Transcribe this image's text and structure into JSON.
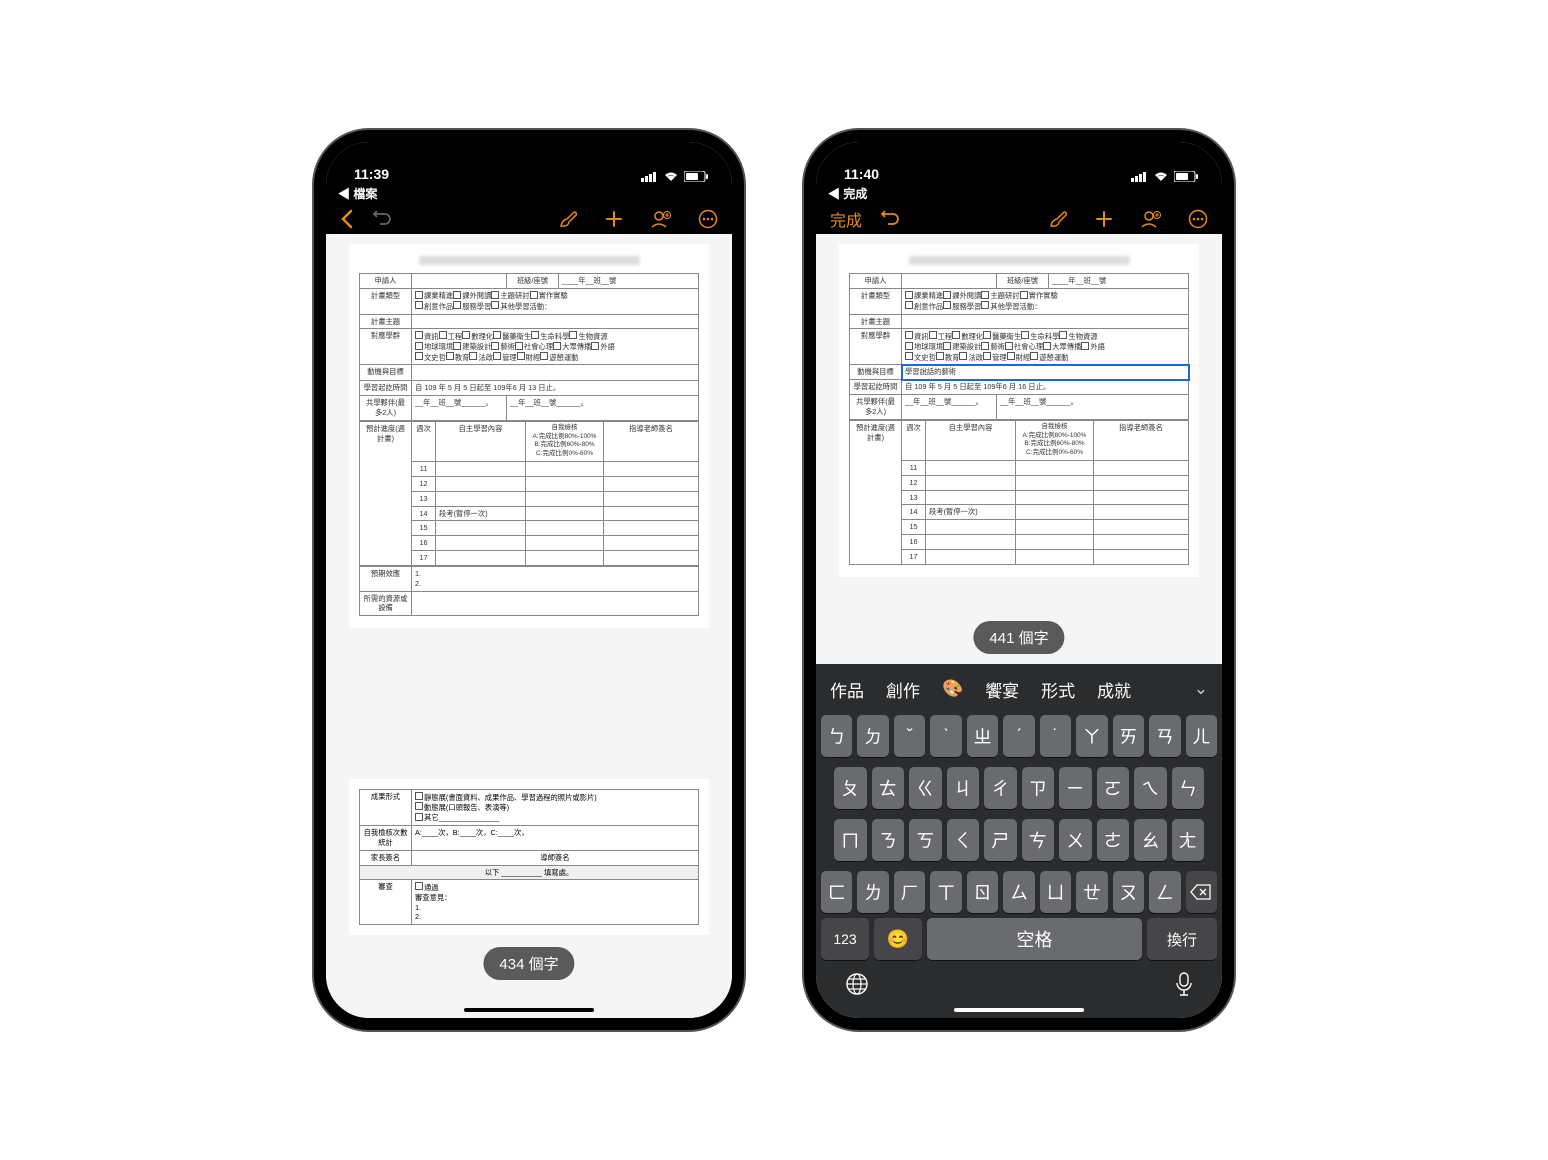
{
  "phoneA": {
    "status": {
      "time": "11:39",
      "backApp": "◀ 檔案"
    },
    "wordCount": "434 個字",
    "form": {
      "row_applicant": "申請人",
      "class_label": "班級/座號",
      "class_value": "____年__班__號",
      "planType_label": "計畫類型",
      "planType_opts": [
        "課業精進",
        "課外閱讀",
        "主題研討",
        "實作實驗",
        "創意作品",
        "服務學習",
        "其他學習活動："
      ],
      "planTopic_label": "計畫主題",
      "group_label": "對應學群",
      "group_opts": [
        "資訊",
        "工程",
        "數理化",
        "醫藥衛生",
        "生命科學",
        "生物資源",
        "地球環境",
        "建築設計",
        "藝術",
        "社會心理",
        "大眾傳播",
        "外語",
        "文史哲",
        "教育",
        "法政",
        "管理",
        "財經",
        "遊憩運動"
      ],
      "motive_label": "動機與目標",
      "period_label": "學習起訖時間",
      "period_value": "自 109 年 5 月 5 日起至 109年6 月 13 日止。",
      "partner_label": "共學夥伴(最多2人)",
      "partner_value1": "__年__班__號______。",
      "partner_value2": "__年__班__號______。",
      "schedule_label": "預計進度(週計畫)",
      "cols": [
        "週次",
        "自主學習內容",
        "自我檢核",
        "指導老師簽名"
      ],
      "checkDesc": [
        "A:完成比例80%-100%",
        "B:完成比例60%-80%",
        "C:完成比例0%-60%"
      ],
      "weeks": [
        "11",
        "12",
        "13",
        "14",
        "15",
        "16",
        "17"
      ],
      "exam": "段考(暫停一次)",
      "expect_label": "預期效應",
      "resource_label": "所需的資源或設備",
      "result_label": "成果形式",
      "result_opts": [
        "靜態展(書面資料、成果作品、學習過程的照片或影片)",
        "動態展(口頭報告、表演等)",
        "其它_______________"
      ],
      "selfcheck_label": "自我檢核次數統計",
      "selfcheck_value": "A:____次，B:____次，C:____次，",
      "parent_label": "家長簽名",
      "teacher_label": "導師簽名",
      "line_below": "以下 __________ 填寫處。",
      "review_label": "審查",
      "review_opt": "通過",
      "review_opinion": "審查意見："
    }
  },
  "phoneB": {
    "status": {
      "time": "11:40",
      "backApp": "◀ 完成"
    },
    "done": "完成",
    "wordCount": "441 個字",
    "formInput": "學習說話的藝術",
    "period_value": "自 109 年 5 月 5 日起至 109年6 月 16 日止。",
    "candidates": [
      "作品",
      "創作",
      "🎨",
      "饗宴",
      "形式",
      "成就"
    ],
    "kbRows": [
      [
        "ㄅ",
        "ㄉ",
        "ˇ",
        "ˋ",
        "ㄓ",
        "ˊ",
        "˙",
        "ㄚ",
        "ㄞ",
        "ㄢ",
        "ㄦ"
      ],
      [
        "ㄆ",
        "ㄊ",
        "ㄍ",
        "ㄐ",
        "ㄔ",
        "ㄗ",
        "ㄧ",
        "ㄛ",
        "ㄟ",
        "ㄣ"
      ],
      [
        "ㄇ",
        "ㄋ",
        "ㄎ",
        "ㄑ",
        "ㄕ",
        "ㄘ",
        "ㄨ",
        "ㄜ",
        "ㄠ",
        "ㄤ"
      ],
      [
        "ㄈ",
        "ㄌ",
        "ㄏ",
        "ㄒ",
        "ㄖ",
        "ㄙ",
        "ㄩ",
        "ㄝ",
        "ㄡ",
        "ㄥ"
      ]
    ],
    "kbBottom": {
      "abc": "123",
      "space": "空格",
      "return": "換行"
    }
  }
}
